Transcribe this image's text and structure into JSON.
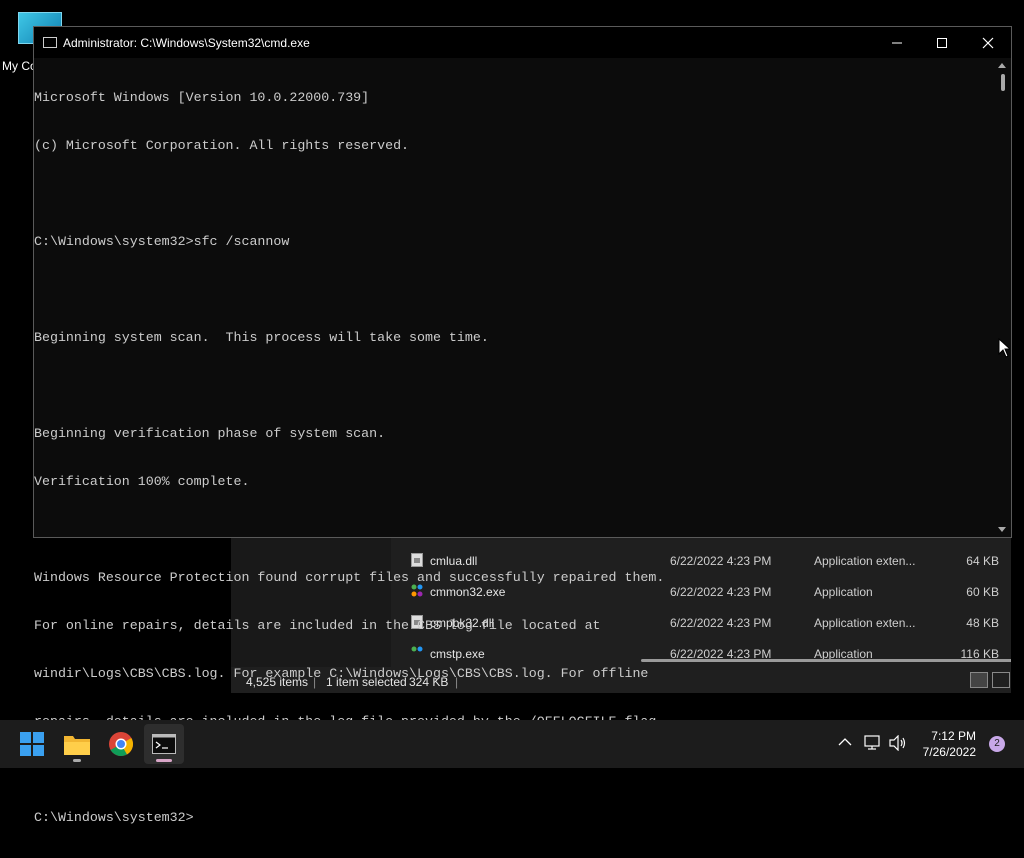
{
  "desktop": {
    "icon_label": "My Co"
  },
  "explorer": {
    "files": [
      {
        "name": "cmlua.dll",
        "date": "6/22/2022 4:23 PM",
        "type": "Application exten...",
        "size": "64 KB",
        "icon": "dll-file-icon"
      },
      {
        "name": "cmmon32.exe",
        "date": "6/22/2022 4:23 PM",
        "type": "Application",
        "size": "60 KB",
        "icon": "exe-file-icon"
      },
      {
        "name": "cmpbk32.dll",
        "date": "6/22/2022 4:23 PM",
        "type": "Application exten...",
        "size": "48 KB",
        "icon": "dll-file-icon"
      },
      {
        "name": "cmstp.exe",
        "date": "6/22/2022 4:23 PM",
        "type": "Application",
        "size": "116 KB",
        "icon": "exe-file-icon"
      }
    ],
    "status": {
      "item_count": "4,525 items",
      "selection": "1 item selected",
      "selection_size": "324 KB"
    }
  },
  "cmd": {
    "title": "Administrator: C:\\Windows\\System32\\cmd.exe",
    "lines": [
      "Microsoft Windows [Version 10.0.22000.739]",
      "(c) Microsoft Corporation. All rights reserved.",
      "",
      "C:\\Windows\\system32>sfc /scannow",
      "",
      "Beginning system scan.  This process will take some time.",
      "",
      "Beginning verification phase of system scan.",
      "Verification 100% complete.",
      "",
      "Windows Resource Protection found corrupt files and successfully repaired them.",
      "For online repairs, details are included in the CBS log file located at",
      "windir\\Logs\\CBS\\CBS.log. For example C:\\Windows\\Logs\\CBS\\CBS.log. For offline",
      "repairs, details are included in the log file provided by the /OFFLOGFILE flag.",
      "",
      "C:\\Windows\\system32>"
    ]
  },
  "taskbar": {
    "apps": [
      "start-icon",
      "file-explorer-icon",
      "chrome-icon",
      "terminal-icon"
    ],
    "time": "7:12 PM",
    "date": "7/26/2022",
    "notification_count": "2"
  }
}
